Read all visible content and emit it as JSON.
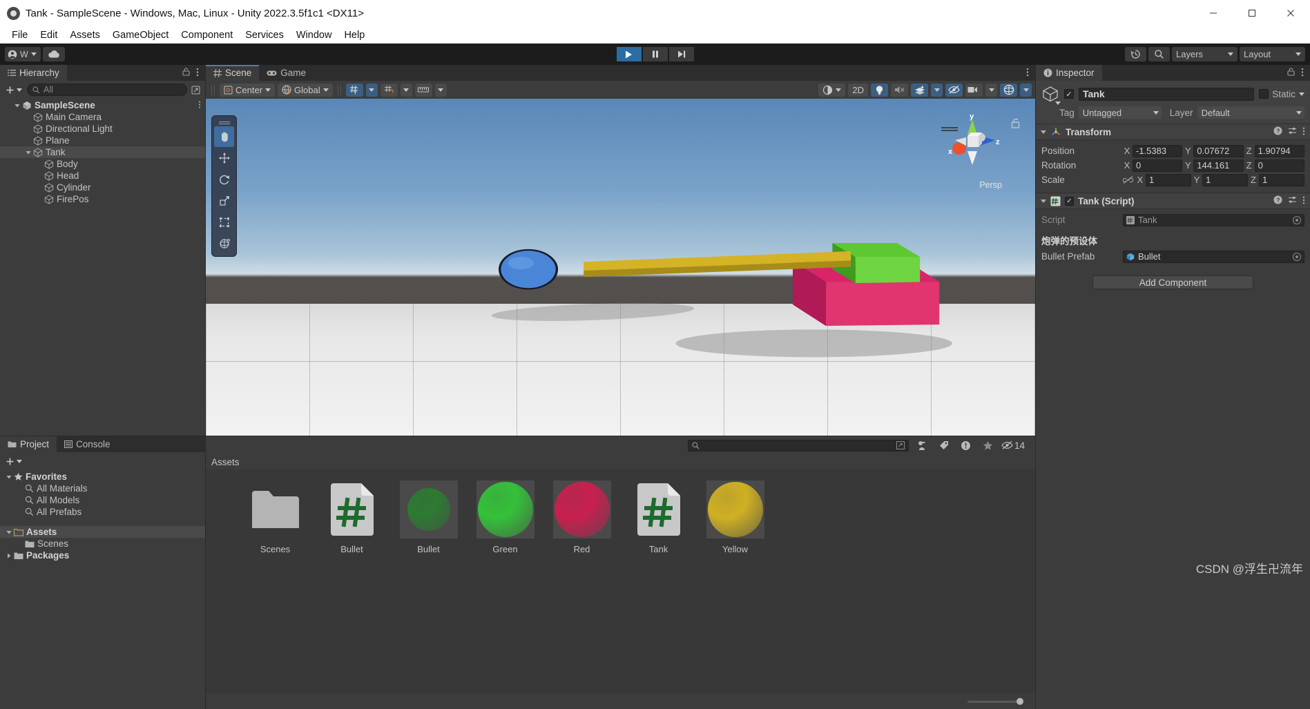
{
  "window": {
    "title": "Tank - SampleScene - Windows, Mac, Linux - Unity 2022.3.5f1c1 <DX11>",
    "app_icon": "unity-icon",
    "minimize": "—",
    "maximize": "☐",
    "close": "✕"
  },
  "menubar": {
    "items": [
      "File",
      "Edit",
      "Assets",
      "GameObject",
      "Component",
      "Services",
      "Window",
      "Help"
    ]
  },
  "toolbar": {
    "account_label": "W",
    "cloud_icon": "cloud-icon",
    "play": "▶",
    "pause": "⏸",
    "step": "⏭",
    "history_icon": "history-icon",
    "search_icon": "search-icon",
    "layers_label": "Layers",
    "layout_label": "Layout"
  },
  "hierarchy": {
    "tab_label": "Hierarchy",
    "search_placeholder": "All",
    "add_label": "+",
    "items": [
      {
        "label": "SampleScene",
        "depth": 0,
        "expanded": true,
        "type": "scene",
        "selected": false,
        "bold": true
      },
      {
        "label": "Main Camera",
        "depth": 1,
        "expanded": null,
        "type": "go",
        "selected": false,
        "bold": false
      },
      {
        "label": "Directional Light",
        "depth": 1,
        "expanded": null,
        "type": "go",
        "selected": false,
        "bold": false
      },
      {
        "label": "Plane",
        "depth": 1,
        "expanded": null,
        "type": "go",
        "selected": false,
        "bold": false
      },
      {
        "label": "Tank",
        "depth": 1,
        "expanded": true,
        "type": "go",
        "selected": true,
        "bold": false
      },
      {
        "label": "Body",
        "depth": 2,
        "expanded": null,
        "type": "go",
        "selected": false,
        "bold": false
      },
      {
        "label": "Head",
        "depth": 2,
        "expanded": null,
        "type": "go",
        "selected": false,
        "bold": false
      },
      {
        "label": "Cylinder",
        "depth": 2,
        "expanded": null,
        "type": "go",
        "selected": false,
        "bold": false
      },
      {
        "label": "FirePos",
        "depth": 2,
        "expanded": null,
        "type": "go",
        "selected": false,
        "bold": false
      }
    ]
  },
  "sceneview": {
    "tabs": [
      {
        "label": "Scene",
        "icon": "scene-grid-icon",
        "active": true
      },
      {
        "label": "Game",
        "icon": "gamepad-icon",
        "active": false
      }
    ],
    "pivot_label": "Center",
    "space_label": "Global",
    "toggle_2d": "2D",
    "gizmo_axes": {
      "x": "x",
      "y": "y",
      "z": "z"
    },
    "persp_label": "Persp",
    "tools": [
      "hand-tool",
      "move-tool",
      "rotate-tool",
      "scale-tool",
      "rect-tool",
      "transform-tool"
    ]
  },
  "inspector": {
    "tab_label": "Inspector",
    "object_name": "Tank",
    "enabled": true,
    "static_label": "Static",
    "tag_label": "Tag",
    "tag_value": "Untagged",
    "layer_label": "Layer",
    "layer_value": "Default",
    "transform": {
      "title": "Transform",
      "rows": [
        {
          "label": "Position",
          "x": "-1.5383",
          "y": "0.07672",
          "z": "1.90794"
        },
        {
          "label": "Rotation",
          "x": "0",
          "y": "144.161",
          "z": "0"
        },
        {
          "label": "Scale",
          "x": "1",
          "y": "1",
          "z": "1"
        }
      ],
      "axis_labels": [
        "X",
        "Y",
        "Z"
      ]
    },
    "script_component": {
      "title": "Tank (Script)",
      "enabled": true,
      "script_label": "Script",
      "script_value": "Tank",
      "section_header": "炮弹的预设体",
      "field_label": "Bullet Prefab",
      "field_value": "Bullet"
    },
    "add_component_label": "Add Component"
  },
  "project": {
    "tabs": [
      {
        "label": "Project",
        "icon": "folder-icon",
        "active": true
      },
      {
        "label": "Console",
        "icon": "console-icon",
        "active": false
      }
    ],
    "search_placeholder": "",
    "hidden_count": "14",
    "tree": [
      {
        "label": "Favorites",
        "depth": 0,
        "type": "star",
        "expanded": true,
        "bold": true,
        "selected": false
      },
      {
        "label": "All Materials",
        "depth": 1,
        "type": "search",
        "expanded": null,
        "bold": false,
        "selected": false
      },
      {
        "label": "All Models",
        "depth": 1,
        "type": "search",
        "expanded": null,
        "bold": false,
        "selected": false
      },
      {
        "label": "All Prefabs",
        "depth": 1,
        "type": "search",
        "expanded": null,
        "bold": false,
        "selected": false
      },
      {
        "label": "",
        "depth": 0,
        "type": "gap",
        "expanded": null,
        "bold": false,
        "selected": false
      },
      {
        "label": "Assets",
        "depth": 0,
        "type": "folder-open",
        "expanded": true,
        "bold": true,
        "selected": true
      },
      {
        "label": "Scenes",
        "depth": 1,
        "type": "folder",
        "expanded": null,
        "bold": false,
        "selected": false
      },
      {
        "label": "Packages",
        "depth": 0,
        "type": "folder",
        "expanded": false,
        "bold": true,
        "selected": false
      }
    ],
    "assets_breadcrumb": "Assets",
    "assets": [
      {
        "name": "Scenes",
        "kind": "folder",
        "color": "#b4b4b4"
      },
      {
        "name": "Bullet",
        "kind": "csharp",
        "color": "#1d6b2d"
      },
      {
        "name": "Bullet",
        "kind": "prefab-sphere",
        "color": "#2d7a32"
      },
      {
        "name": "Green",
        "kind": "material",
        "color": "#35c03a"
      },
      {
        "name": "Red",
        "kind": "material",
        "color": "#c7204f"
      },
      {
        "name": "Tank",
        "kind": "csharp",
        "color": "#1d6b2d"
      },
      {
        "name": "Yellow",
        "kind": "material",
        "color": "#cfb024"
      }
    ]
  },
  "watermark": {
    "text": "CSDN @浮生卍流年"
  }
}
